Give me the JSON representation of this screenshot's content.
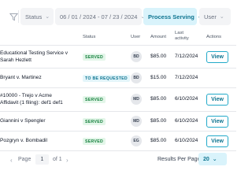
{
  "filters": {
    "status": "Status",
    "date_range": "06 / 01 / 2024 - 07 / 23 / 2024",
    "service": "Process Serving",
    "user": "User"
  },
  "table": {
    "headers": {
      "status": "Status",
      "user": "User",
      "amount": "Amount",
      "last_activity": "Last activity",
      "actions": "Actions"
    },
    "rows": [
      {
        "case_line1": "Educational Testing Service v",
        "case_line2": "Sarah Hezlett",
        "status": "SERVED",
        "user": "BD",
        "amount": "$85.00",
        "last_activity": "7/12/2024",
        "action": "View"
      },
      {
        "case_line1": "Bryant v. Martinez",
        "case_line2": "",
        "status": "TO BE REQUESTED",
        "user": "BD",
        "amount": "$15.00",
        "last_activity": "7/12/2024",
        "action": ""
      },
      {
        "case_line1": "#10000 - Trejo v Acme",
        "case_line2": "Affidavit (1 filing): def1 def1",
        "status": "SERVED",
        "user": "MD",
        "amount": "$85.00",
        "last_activity": "6/10/2024",
        "action": "View"
      },
      {
        "case_line1": "Giannini v Spengler",
        "case_line2": "",
        "status": "SERVED",
        "user": "MD",
        "amount": "$85.00",
        "last_activity": "6/10/2024",
        "action": "View"
      },
      {
        "case_line1": "Pozgryn v. Bombadil",
        "case_line2": "",
        "status": "SERVED",
        "user": "EG",
        "amount": "$85.00",
        "last_activity": "6/10/2024",
        "action": "View"
      }
    ]
  },
  "pagination": {
    "page_label": "Page",
    "current_page": "1",
    "of_label": "of 1",
    "results_per_page_label": "Results Per Page:",
    "results_per_page": "20"
  },
  "colors": {
    "accent": "#0e7490",
    "accent_bg": "#d9f3fb",
    "served_bg": "#e3f6e9",
    "served_text": "#15803d"
  },
  "icons": {
    "filter": "filter-icon",
    "dropdown": "chevron-down-icon",
    "prev": "chevron-left-icon",
    "next": "chevron-right-icon"
  }
}
